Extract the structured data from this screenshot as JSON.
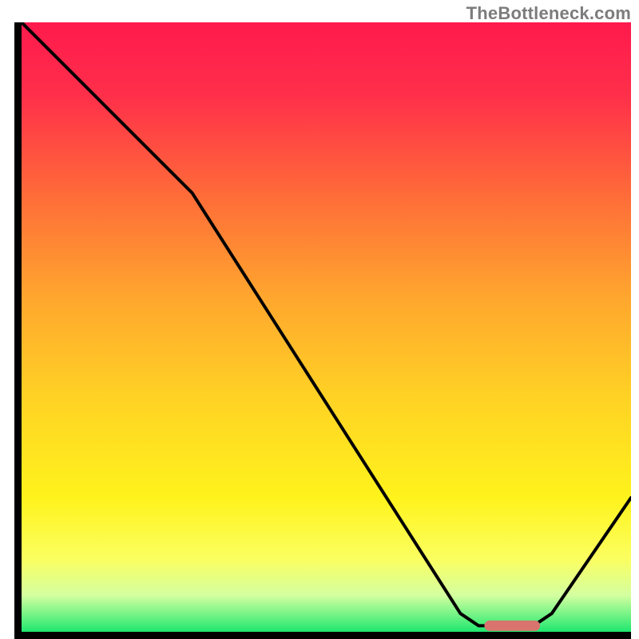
{
  "watermark": "TheBottleneck.com",
  "colors": {
    "gradient_stops": [
      {
        "offset": 0.0,
        "color": "#ff1a4d"
      },
      {
        "offset": 0.12,
        "color": "#ff2f4a"
      },
      {
        "offset": 0.28,
        "color": "#ff6a39"
      },
      {
        "offset": 0.45,
        "color": "#ffa62e"
      },
      {
        "offset": 0.62,
        "color": "#ffd324"
      },
      {
        "offset": 0.78,
        "color": "#fff31c"
      },
      {
        "offset": 0.88,
        "color": "#fbff60"
      },
      {
        "offset": 0.94,
        "color": "#d4ffa0"
      },
      {
        "offset": 1.0,
        "color": "#1ee86f"
      }
    ],
    "curve": "#000000",
    "marker_fill": "#d9736e",
    "marker_stroke": "#d9736e",
    "axis": "#000000"
  },
  "chart_data": {
    "type": "line",
    "title": "",
    "xlabel": "",
    "ylabel": "",
    "xlim": [
      0,
      100
    ],
    "ylim": [
      0,
      100
    ],
    "curve": [
      {
        "x": 0,
        "y": 100
      },
      {
        "x": 22,
        "y": 78
      },
      {
        "x": 28,
        "y": 72
      },
      {
        "x": 72,
        "y": 3
      },
      {
        "x": 75,
        "y": 1
      },
      {
        "x": 84,
        "y": 1
      },
      {
        "x": 87,
        "y": 3
      },
      {
        "x": 100,
        "y": 22
      }
    ],
    "marker_band": {
      "x_start": 76,
      "x_end": 85,
      "y": 1
    },
    "annotations": []
  }
}
